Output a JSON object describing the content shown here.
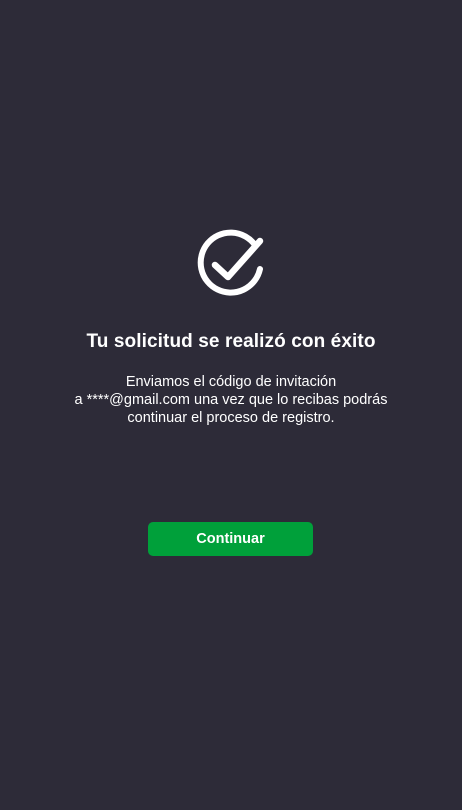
{
  "success": {
    "icon": "check-circle-icon",
    "title": "Tu solicitud se realizó con éxito",
    "message_lines": [
      "Enviamos el código de invitación",
      "a ****@gmail.com una vez que lo recibas podrás",
      "continuar el proceso de registro."
    ]
  },
  "actions": {
    "continue_label": "Continuar"
  },
  "colors": {
    "background": "#2d2b38",
    "primary_button": "#00a03a",
    "text": "#ffffff"
  }
}
